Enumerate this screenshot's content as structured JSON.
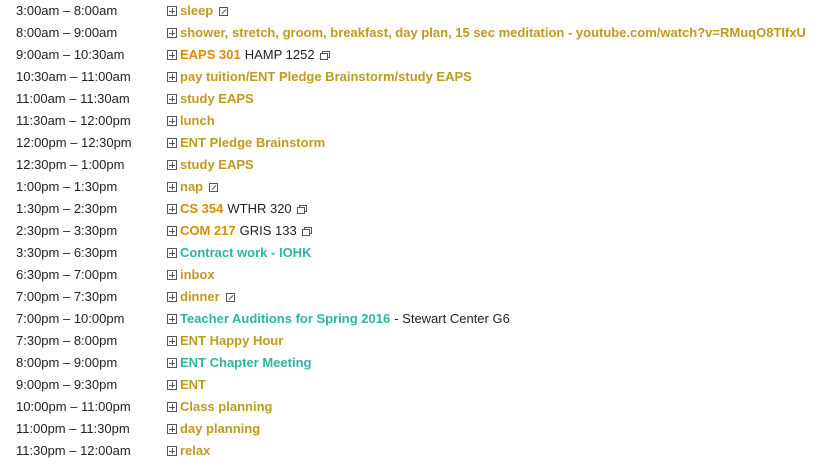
{
  "colors": {
    "gold": "#c09a1f",
    "orange": "#d98c00",
    "teal": "#2db5a0",
    "text": "#222222"
  },
  "events": [
    {
      "time": "3:00am – 8:00am",
      "title": "sleep",
      "color": "#c09a1f",
      "trail_icon": "declined-icon"
    },
    {
      "time": "8:00am – 9:00am",
      "title": "shower, stretch, groom, breakfast, day plan, 15 sec meditation - youtube.com/watch?v=RMuqO8TIfxU",
      "color": "#c09a1f"
    },
    {
      "time": "9:00am – 10:30am",
      "title": "EAPS 301",
      "color": "#d98c00",
      "location": "HAMP 1252",
      "trail_icon": "popup-icon"
    },
    {
      "time": "10:30am – 11:00am",
      "title": "pay tuition/ENT Pledge Brainstorm/study EAPS",
      "color": "#c09a1f"
    },
    {
      "time": "11:00am – 11:30am",
      "title": "study EAPS",
      "color": "#c09a1f"
    },
    {
      "time": "11:30am – 12:00pm",
      "title": "lunch",
      "color": "#c09a1f"
    },
    {
      "time": "12:00pm – 12:30pm",
      "title": "ENT Pledge Brainstorm",
      "color": "#c09a1f"
    },
    {
      "time": "12:30pm – 1:00pm",
      "title": "study EAPS",
      "color": "#c09a1f"
    },
    {
      "time": "1:00pm – 1:30pm",
      "title": "nap",
      "color": "#c09a1f",
      "trail_icon": "declined-icon"
    },
    {
      "time": "1:30pm – 2:30pm",
      "title": "CS 354",
      "color": "#d98c00",
      "location": "WTHR 320",
      "trail_icon": "popup-icon"
    },
    {
      "time": "2:30pm – 3:30pm",
      "title": "COM 217",
      "color": "#d98c00",
      "location": "GRIS 133",
      "trail_icon": "popup-icon"
    },
    {
      "time": "3:30pm – 6:30pm",
      "title": "Contract work - IOHK",
      "color": "#2db5a0"
    },
    {
      "time": "6:30pm – 7:00pm",
      "title": "inbox",
      "color": "#c09a1f"
    },
    {
      "time": "7:00pm – 7:30pm",
      "title": "dinner",
      "color": "#c09a1f",
      "trail_icon": "declined-icon"
    },
    {
      "time": "7:00pm – 10:00pm",
      "title": "Teacher Auditions for Spring 2016",
      "color": "#2db5a0",
      "location": "- Stewart Center G6"
    },
    {
      "time": "7:30pm – 8:00pm",
      "title": "ENT Happy Hour",
      "color": "#c09a1f"
    },
    {
      "time": "8:00pm – 9:00pm",
      "title": "ENT Chapter Meeting",
      "color": "#2db5a0"
    },
    {
      "time": "9:00pm – 9:30pm",
      "title": "ENT",
      "color": "#c09a1f"
    },
    {
      "time": "10:00pm – 11:00pm",
      "title": "Class planning",
      "color": "#c09a1f"
    },
    {
      "time": "11:00pm – 11:30pm",
      "title": "day planning",
      "color": "#c09a1f"
    },
    {
      "time": "11:30pm – 12:00am",
      "title": "relax",
      "color": "#c09a1f"
    }
  ]
}
